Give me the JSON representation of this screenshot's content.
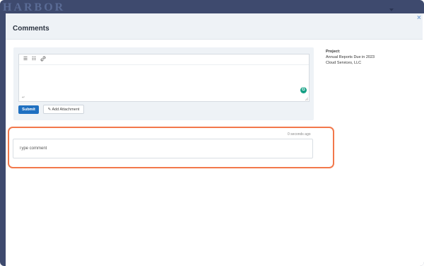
{
  "background": {
    "brand_text": "HARBOR"
  },
  "modal": {
    "title": "Comments",
    "close_label": "×"
  },
  "editor": {
    "toolbar": [
      {
        "name": "ordered-list-icon",
        "glyph": "☰"
      },
      {
        "name": "bullet-list-icon",
        "glyph": "☷"
      },
      {
        "name": "link-icon",
        "glyph": "🔗"
      }
    ],
    "paragraph_mark": "↵",
    "grammarly_label": "G"
  },
  "buttons": {
    "submit": "Submit",
    "add_attachment": "✎ Add Attachment"
  },
  "project": {
    "label": "Project:",
    "line1": "Annual Reports Due in 2023",
    "line2": "Cloud Services, LLC"
  },
  "comment": {
    "timestamp": "0 seconds ago",
    "placeholder": "Type comment"
  },
  "colors": {
    "primary": "#1f70c1",
    "highlight": "#f2784b",
    "header_bg": "#eef2f6",
    "backdrop": "#3e4a6e"
  }
}
